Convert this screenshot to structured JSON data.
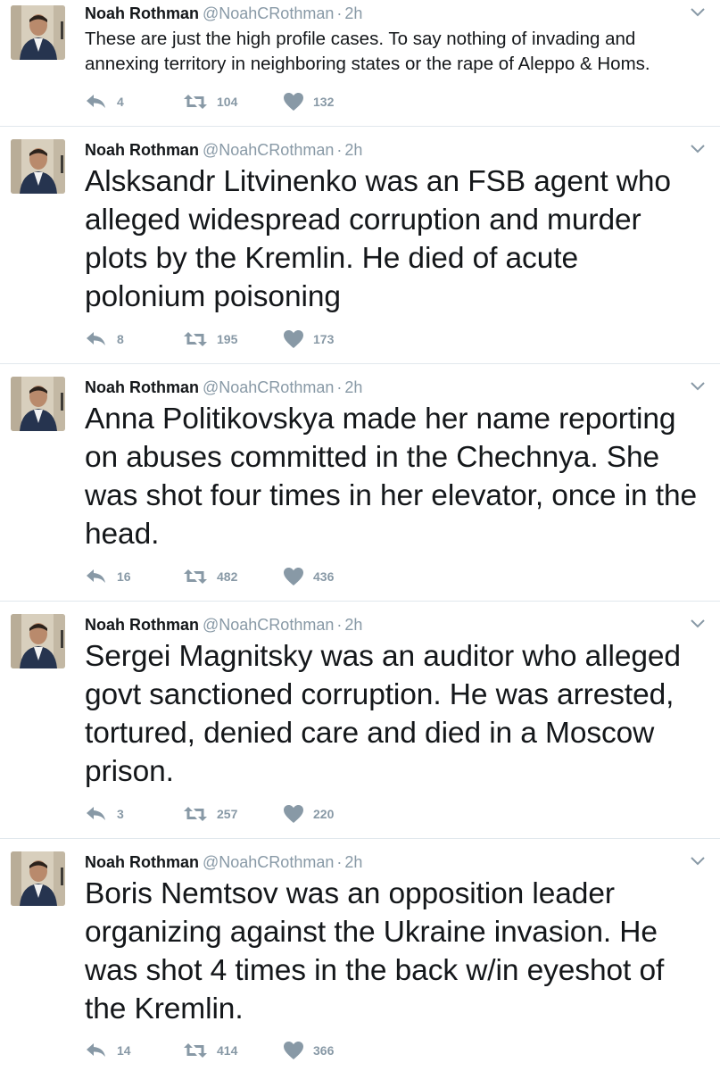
{
  "tweets": [
    {
      "name": "Noah Rothman",
      "handle": "@NoahCRothman",
      "separator": "·",
      "time": "2h",
      "text": "These are just the high profile cases. To say nothing of invading and annexing territory in neighboring states or the rape of Aleppo & Homs.",
      "text_size": "small",
      "replies": "4",
      "retweets": "104",
      "likes": "132"
    },
    {
      "name": "Noah Rothman",
      "handle": "@NoahCRothman",
      "separator": "·",
      "time": "2h",
      "text": "Alsksandr Litvinenko was an FSB agent who alleged widespread corruption and murder plots by the Kremlin. He died of acute polonium poisoning",
      "text_size": "large",
      "replies": "8",
      "retweets": "195",
      "likes": "173"
    },
    {
      "name": "Noah Rothman",
      "handle": "@NoahCRothman",
      "separator": "·",
      "time": "2h",
      "text": "Anna Politikovskya made her name reporting on abuses committed in the Chechnya. She was shot four times in her elevator, once in the head.",
      "text_size": "large",
      "replies": "16",
      "retweets": "482",
      "likes": "436"
    },
    {
      "name": "Noah Rothman",
      "handle": "@NoahCRothman",
      "separator": "·",
      "time": "2h",
      "text": "Sergei Magnitsky was an auditor who alleged govt sanctioned corruption. He was arrested, tortured, denied care and died in a Moscow prison.",
      "text_size": "large",
      "replies": "3",
      "retweets": "257",
      "likes": "220"
    },
    {
      "name": "Noah Rothman",
      "handle": "@NoahCRothman",
      "separator": "·",
      "time": "2h",
      "text": "Boris Nemtsov was an opposition leader organizing against the Ukraine invasion. He was shot 4 times in the back w/in eyeshot of the Kremlin.",
      "text_size": "large",
      "replies": "14",
      "retweets": "414",
      "likes": "366"
    }
  ],
  "icons": {
    "reply": "reply-icon",
    "retweet": "retweet-icon",
    "like": "heart-icon",
    "caret": "chevron-down-icon",
    "avatar": "avatar"
  },
  "colors": {
    "name": "#14171a",
    "meta": "#8899a6",
    "border": "#e1e8ed"
  }
}
